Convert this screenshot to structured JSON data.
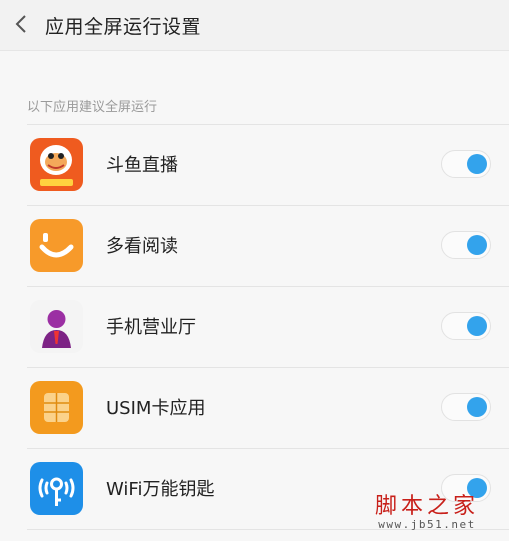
{
  "header": {
    "title": "应用全屏运行设置",
    "back_icon": "chevron-left-icon"
  },
  "section": {
    "label": "以下应用建议全屏运行"
  },
  "apps": [
    {
      "name": "斗鱼直播",
      "icon": "douyu-app-icon",
      "enabled": true
    },
    {
      "name": "多看阅读",
      "icon": "duokan-app-icon",
      "enabled": true
    },
    {
      "name": "手机营业厅",
      "icon": "mobile-hall-app-icon",
      "enabled": true
    },
    {
      "name": "USIM卡应用",
      "icon": "usim-app-icon",
      "enabled": true
    },
    {
      "name": "WiFi万能钥匙",
      "icon": "wifi-key-app-icon",
      "enabled": true
    }
  ],
  "colors": {
    "toggle_on": "#33a3ec",
    "watermark": "#c8201a"
  },
  "watermark": {
    "text": "脚本之家",
    "url": "www.jb51.net"
  }
}
